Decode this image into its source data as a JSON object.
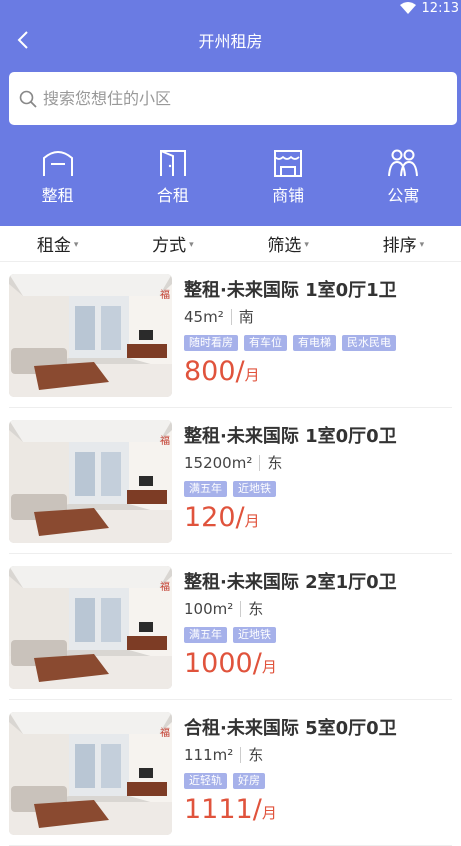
{
  "status": {
    "time": "12:13"
  },
  "header": {
    "title": "开州租房"
  },
  "search": {
    "placeholder": "搜索您想住的小区"
  },
  "categories": [
    {
      "label": "整租",
      "icon": "house-icon"
    },
    {
      "label": "合租",
      "icon": "door-icon"
    },
    {
      "label": "商铺",
      "icon": "shop-icon"
    },
    {
      "label": "公寓",
      "icon": "people-icon"
    }
  ],
  "filters": [
    {
      "label": "租金"
    },
    {
      "label": "方式"
    },
    {
      "label": "筛选"
    },
    {
      "label": "排序"
    }
  ],
  "listings": [
    {
      "title": "整租·未来国际 1室0厅1卫",
      "area": "45m²",
      "direction": "南",
      "tags": [
        "随时看房",
        "有车位",
        "有电梯",
        "民水民电"
      ],
      "price": "800",
      "unit": "月"
    },
    {
      "title": "整租·未来国际 1室0厅0卫",
      "area": "15200m²",
      "direction": "东",
      "tags": [
        "满五年",
        "近地铁"
      ],
      "price": "120",
      "unit": "月"
    },
    {
      "title": "整租·未来国际 2室1厅0卫",
      "area": "100m²",
      "direction": "东",
      "tags": [
        "满五年",
        "近地铁"
      ],
      "price": "1000",
      "unit": "月"
    },
    {
      "title": "合租·未来国际 5室0厅0卫",
      "area": "111m²",
      "direction": "东",
      "tags": [
        "近轻轨",
        "好房"
      ],
      "price": "1111",
      "unit": "月"
    }
  ],
  "colors": {
    "primary": "#6a7be3",
    "price": "#e0533c",
    "tag": "#a6b1ea"
  }
}
